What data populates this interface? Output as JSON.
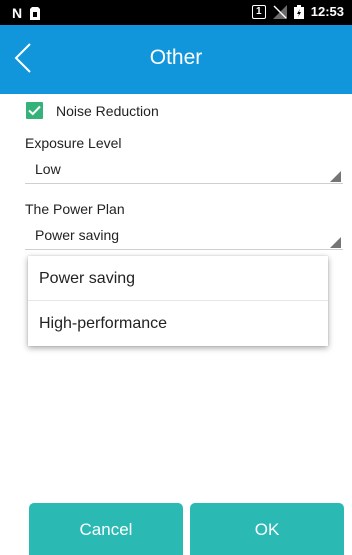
{
  "status_bar": {
    "left_icons": [
      "n-icon",
      "sim-alert-icon"
    ],
    "sim_label": "1",
    "time": "12:53"
  },
  "header": {
    "title": "Other",
    "color": "#1296db"
  },
  "settings": {
    "noise_reduction": {
      "label": "Noise Reduction",
      "checked": true
    },
    "exposure": {
      "label": "Exposure Level",
      "value": "Low"
    },
    "power_plan": {
      "label": "The Power Plan",
      "value": "Power saving"
    }
  },
  "dropdown": {
    "options": [
      "Power saving",
      "High-performance"
    ]
  },
  "buttons": {
    "cancel_label": "Cancel",
    "ok_label": "OK",
    "color": "#2bb9b4"
  }
}
